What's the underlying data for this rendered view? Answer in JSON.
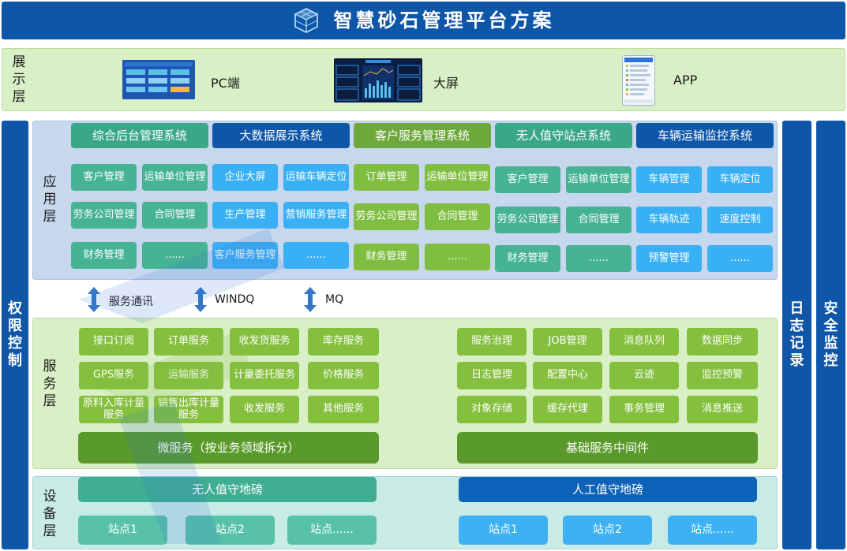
{
  "title": "智慧砂石管理平台方案",
  "display_layer": {
    "label": [
      "展",
      "示",
      "层"
    ],
    "items": [
      {
        "label": "PC端"
      },
      {
        "label": "大屏"
      },
      {
        "label": "APP"
      }
    ]
  },
  "left_column": {
    "label": [
      "权",
      "限",
      "控",
      "制"
    ]
  },
  "right_columns": [
    {
      "label": [
        "日",
        "志",
        "记",
        "录"
      ]
    },
    {
      "label": [
        "安",
        "全",
        "监",
        "控"
      ]
    }
  ],
  "app_layer": {
    "label": [
      "应",
      "用",
      "层"
    ],
    "systems": [
      {
        "name": "综合后台管理系统",
        "color": "#3aa888",
        "cells": [
          [
            "客户管理",
            "运输单位管理"
          ],
          [
            "劳务公司管理",
            "合同管理"
          ],
          [
            "财务管理",
            "......"
          ]
        ]
      },
      {
        "name": "大数据展示系统",
        "color": "#0e56a8",
        "cells": [
          [
            "企业大屏",
            "运输车辆定位"
          ],
          [
            "生产管理",
            "营销服务管理"
          ],
          [
            "客户服务管理",
            "......"
          ]
        ]
      },
      {
        "name": "客户服务管理系统",
        "color": "#6ea83c",
        "cells": [
          [
            "订单管理",
            "运输单位管理"
          ],
          [
            "劳务公司管理",
            "合同管理"
          ],
          [
            "财务管理",
            "......"
          ]
        ]
      },
      {
        "name": "无人值守站点系统",
        "color": "#3aa888",
        "cells": [
          [
            "客户管理",
            "运输单位管理"
          ],
          [
            "劳务公司管理",
            "合同管理"
          ],
          [
            "财务管理",
            "......"
          ]
        ]
      },
      {
        "name": "车辆运输监控系统",
        "color": "#0e56a8",
        "cells": [
          [
            "车辆管理",
            "车辆定位"
          ],
          [
            "车辆轨迹",
            "速度控制"
          ],
          [
            "预警管理",
            "......"
          ]
        ]
      }
    ]
  },
  "protocols": [
    {
      "label": "服务通讯"
    },
    {
      "label": "WINDQ"
    },
    {
      "label": "MQ"
    }
  ],
  "service_layer": {
    "label": [
      "服",
      "务",
      "层"
    ],
    "left_grid": [
      [
        "接口订阅",
        "订单服务",
        "收发货服务",
        "库存服务"
      ],
      [
        "GPS服务",
        "运输服务",
        "计量委托服务",
        "价格服务"
      ],
      [
        "原料入库计量服务",
        "销售出库计量服务",
        "收发服务",
        "其他服务"
      ]
    ],
    "left_bar": "微服务（按业务领域拆分）",
    "right_grid": [
      [
        "服务治理",
        "JOB管理",
        "消息队列",
        "数据同步"
      ],
      [
        "日志管理",
        "配置中心",
        "云迹",
        "监控预警"
      ],
      [
        "对象存储",
        "缓存代理",
        "事务管理",
        "消息推送"
      ]
    ],
    "right_bar": "基础服务中间件"
  },
  "device_layer": {
    "label": [
      "设",
      "备",
      "层"
    ],
    "left": {
      "name": "无人值守地磅",
      "stations": [
        "站点1",
        "站点2",
        "站点......"
      ]
    },
    "right": {
      "name": "人工值守地磅",
      "stations": [
        "站点1",
        "站点2",
        "站点......"
      ]
    }
  }
}
